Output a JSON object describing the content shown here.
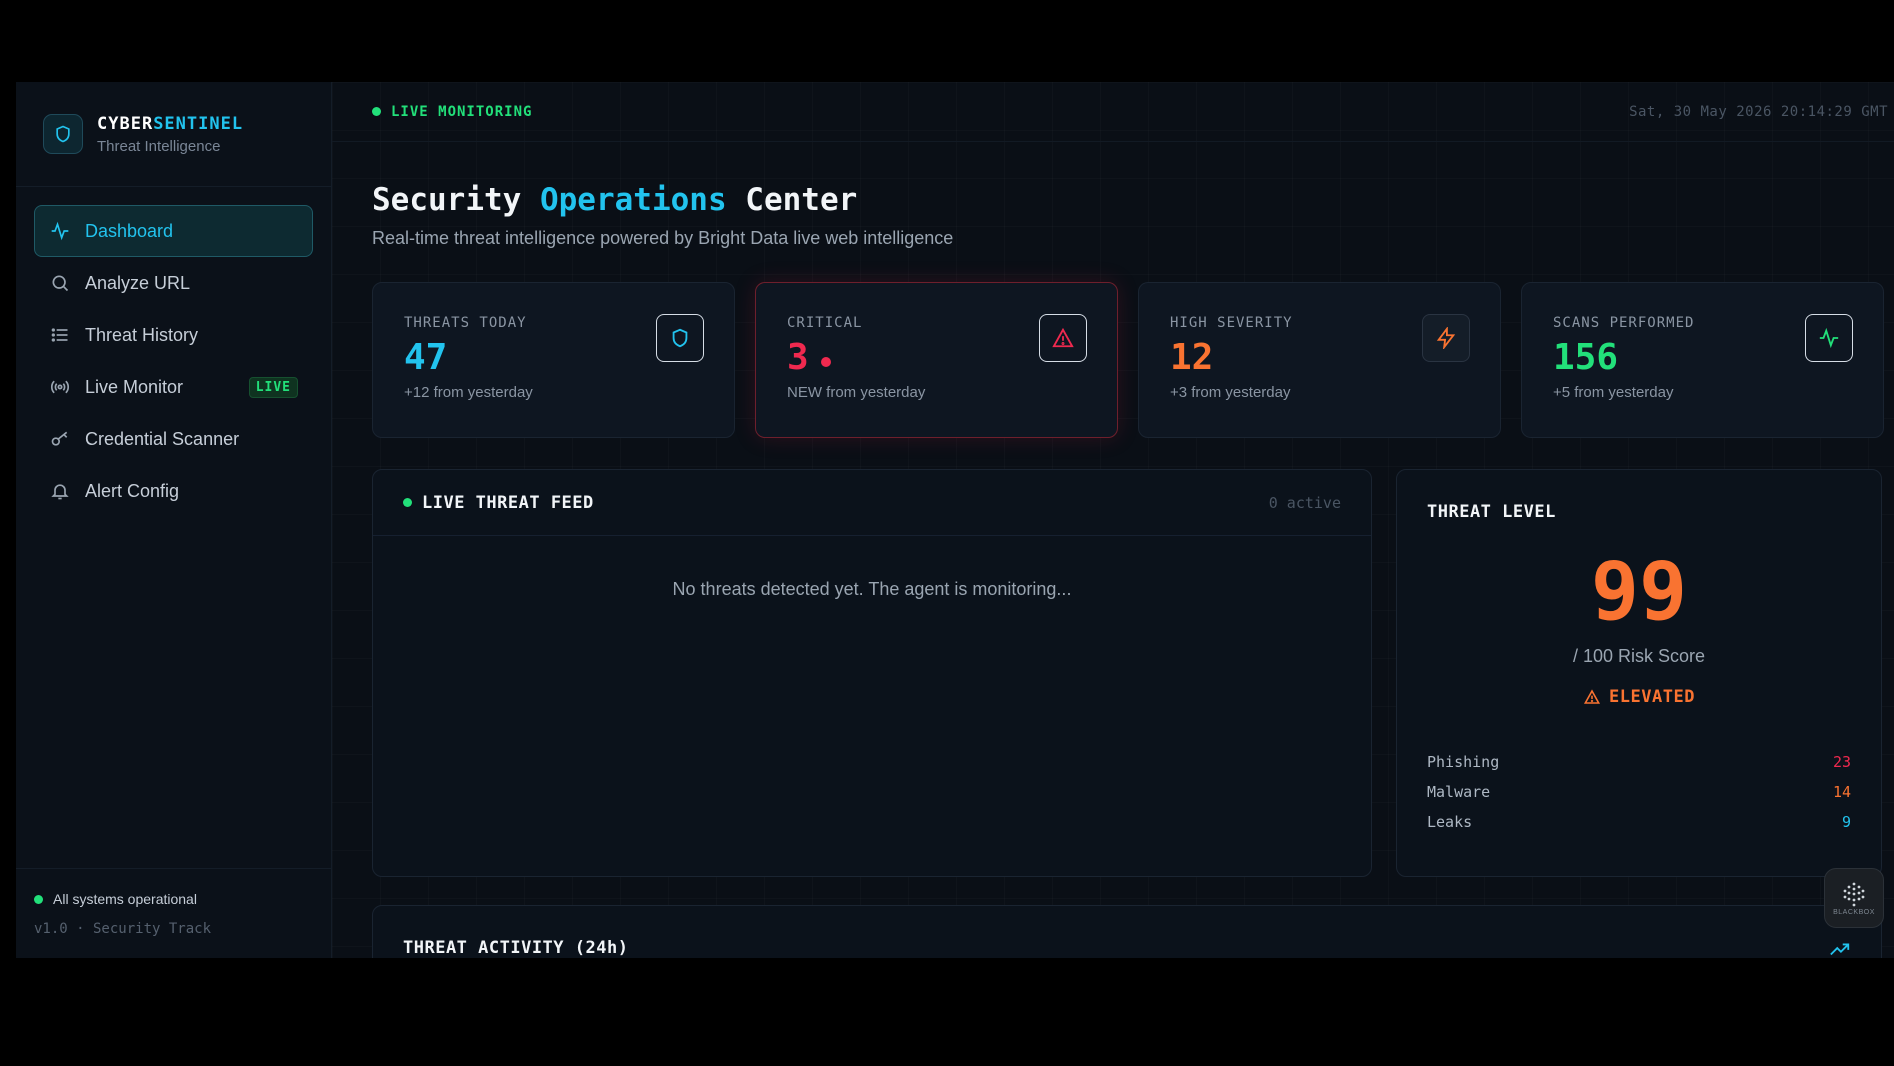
{
  "brand": {
    "name_a": "CYBER",
    "name_b": "SENTINEL",
    "subtitle": "Threat Intelligence"
  },
  "sidebar": {
    "items": [
      {
        "label": "Dashboard",
        "icon": "activity-icon",
        "active": true
      },
      {
        "label": "Analyze URL",
        "icon": "search-icon"
      },
      {
        "label": "Threat History",
        "icon": "list-icon"
      },
      {
        "label": "Live Monitor",
        "icon": "broadcast-icon",
        "badge": "LIVE"
      },
      {
        "label": "Credential Scanner",
        "icon": "key-icon"
      },
      {
        "label": "Alert Config",
        "icon": "bell-icon"
      }
    ],
    "status": "All systems operational",
    "version": "v1.0 · Security Track"
  },
  "topbar": {
    "live_label": "LIVE MONITORING",
    "datetime": "Sat, 30 May 2026 20:14:29 GMT"
  },
  "page": {
    "title_a": "Security ",
    "title_b": "Operations",
    "title_c": " Center",
    "subtitle": "Real-time threat intelligence powered by Bright Data live web intelligence"
  },
  "stats": [
    {
      "label": "THREATS TODAY",
      "value": "47",
      "note": "+12 from yesterday",
      "color": "#22c3ee",
      "icon": "shield-icon"
    },
    {
      "label": "CRITICAL",
      "value": "3",
      "note": "NEW from yesterday",
      "color": "#f0294f",
      "icon": "alert-triangle-icon"
    },
    {
      "label": "HIGH SEVERITY",
      "value": "12",
      "note": "+3 from yesterday",
      "color": "#f97331",
      "icon": "zap-icon"
    },
    {
      "label": "SCANS PERFORMED",
      "value": "156",
      "note": "+5 from yesterday",
      "color": "#22e07a",
      "icon": "pulse-icon"
    }
  ],
  "feed": {
    "title": "LIVE THREAT FEED",
    "count": "0 active",
    "empty": "No threats detected yet. The agent is monitoring..."
  },
  "threat_level": {
    "title": "THREAT LEVEL",
    "score": "99",
    "score_sub": "/ 100 Risk Score",
    "status": "ELEVATED",
    "breakdown": [
      {
        "label": "Phishing",
        "value": "23",
        "color": "#f0294f"
      },
      {
        "label": "Malware",
        "value": "14",
        "color": "#f97331"
      },
      {
        "label": "Leaks",
        "value": "9",
        "color": "#22c3ee"
      }
    ]
  },
  "activity": {
    "title": "THREAT ACTIVITY (24h)"
  },
  "widget": {
    "label": "BLACKBOX"
  },
  "colors": {
    "accent": "#22c3ee",
    "ok": "#22e07a",
    "critical": "#f0294f",
    "warn": "#f97331"
  }
}
